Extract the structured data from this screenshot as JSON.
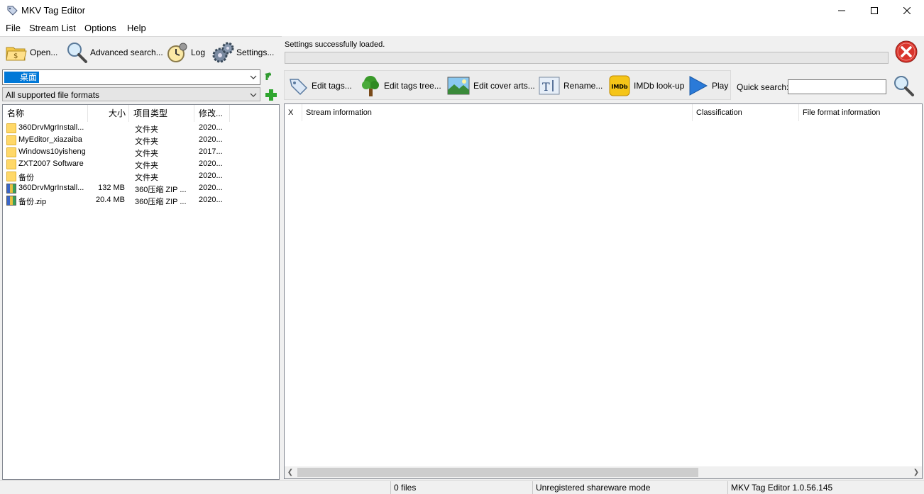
{
  "window": {
    "title": "MKV Tag Editor",
    "minimize_glyph": "—",
    "maximize_glyph": "☐",
    "close_glyph": "✕"
  },
  "menu": [
    "File",
    "Stream List",
    "Options",
    "Help"
  ],
  "left_toolbar": [
    {
      "label": "Open...",
      "icon": "open-folder-icon"
    },
    {
      "label": "Advanced search...",
      "icon": "magnifier-icon"
    },
    {
      "label": "Log",
      "icon": "clock-icon"
    },
    {
      "label": "Settings...",
      "icon": "gears-icon"
    }
  ],
  "folder_select": {
    "value": "桌面",
    "icon": "desktop-icon"
  },
  "format_select": {
    "value": "All supported file formats"
  },
  "file_list": {
    "columns": [
      "名称",
      "大小",
      "项目类型",
      "修改..."
    ],
    "rows": [
      {
        "name": "360DrvMgrInstall...",
        "size": "",
        "type": "文件夹",
        "modified": "2020...",
        "kind": "folder"
      },
      {
        "name": "MyEditor_xiazaiba",
        "size": "",
        "type": "文件夹",
        "modified": "2020...",
        "kind": "folder"
      },
      {
        "name": "Windows10yisheng",
        "size": "",
        "type": "文件夹",
        "modified": "2017...",
        "kind": "folder"
      },
      {
        "name": "ZXT2007 Software",
        "size": "",
        "type": "文件夹",
        "modified": "2020...",
        "kind": "folder"
      },
      {
        "name": "备份",
        "size": "",
        "type": "文件夹",
        "modified": "2020...",
        "kind": "folder"
      },
      {
        "name": "360DrvMgrInstall...",
        "size": "132 MB",
        "type": "360压缩 ZIP ...",
        "modified": "2020...",
        "kind": "zip"
      },
      {
        "name": "备份.zip",
        "size": "20.4 MB",
        "type": "360压缩 ZIP ...",
        "modified": "2020...",
        "kind": "zip"
      }
    ]
  },
  "status_message": "Settings successfully loaded.",
  "progress_value": 0,
  "right_toolbar": [
    {
      "label": "Edit tags...",
      "icon": "tag-icon"
    },
    {
      "label": "Edit tags tree...",
      "icon": "tree-icon"
    },
    {
      "label": "Edit cover arts...",
      "icon": "picture-icon"
    },
    {
      "label": "Rename...",
      "icon": "text-cursor-icon"
    },
    {
      "label": "IMDb look-up",
      "icon": "imdb-icon",
      "badge": "IMDb"
    },
    {
      "label": "Play",
      "icon": "play-icon"
    }
  ],
  "quick_search": {
    "label": "Quick search:",
    "value": ""
  },
  "stream_table": {
    "columns": [
      "X",
      "Stream information",
      "Classification",
      "File format information"
    ]
  },
  "status_bar": [
    "0 files",
    "Unregistered shareware mode",
    "MKV Tag Editor 1.0.56.145"
  ],
  "colors": {
    "selection": "#0078d7",
    "stop_red": "#d9342b",
    "imdb_yellow": "#f5c518"
  }
}
